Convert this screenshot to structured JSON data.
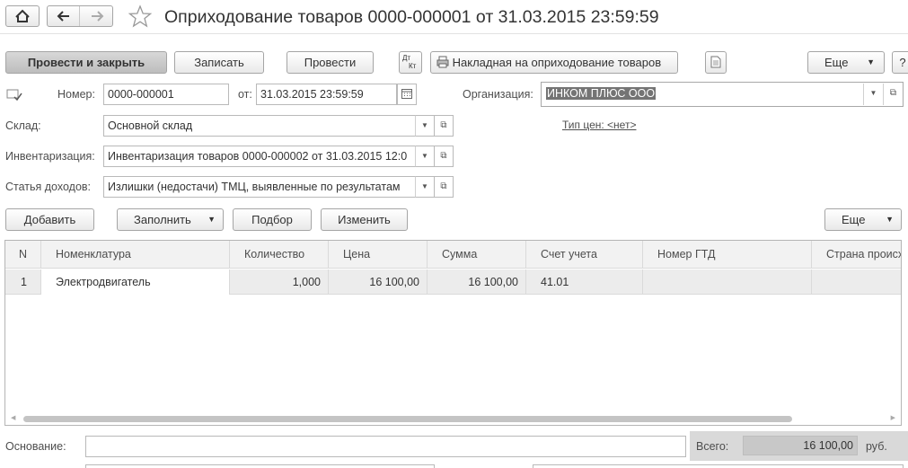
{
  "window": {
    "title": "Оприходование товаров 0000-000001 от 31.03.2015 23:59:59"
  },
  "toolbar": {
    "post_close": "Провести и закрыть",
    "save": "Записать",
    "post": "Провести",
    "dtkt_top": "Дт",
    "dtkt_bottom": "Кт",
    "print_report": "Накладная на оприходование товаров",
    "more": "Еще",
    "help": "?"
  },
  "form": {
    "number_label": "Номер:",
    "number_value": "0000-000001",
    "date_label": "от:",
    "date_value": "31.03.2015 23:59:59",
    "org_label": "Организация:",
    "org_value": "ИНКОМ ПЛЮС ООО",
    "warehouse_label": "Склад:",
    "warehouse_value": "Основной склад",
    "price_type_link": "Тип цен: <нет>",
    "inventory_label": "Инвентаризация:",
    "inventory_value": "Инвентаризация товаров 0000-000002 от 31.03.2015 12:0",
    "income_label": "Статья доходов:",
    "income_value": "Излишки (недостачи) ТМЦ, выявленные по результатам"
  },
  "table_toolbar": {
    "add": "Добавить",
    "fill": "Заполнить",
    "select": "Подбор",
    "change": "Изменить",
    "more": "Еще"
  },
  "table": {
    "columns": [
      "N",
      "Номенклатура",
      "Количество",
      "Цена",
      "Сумма",
      "Счет учета",
      "Номер ГТД",
      "Страна происх"
    ],
    "rows": [
      [
        "1",
        "Электродвигатель",
        "1,000",
        "16 100,00",
        "16 100,00",
        "41.01",
        "",
        ""
      ]
    ]
  },
  "footer": {
    "basis_label": "Основание:",
    "basis_value": "",
    "total_label": "Всего:",
    "total_value": "16 100,00",
    "currency": "руб."
  }
}
